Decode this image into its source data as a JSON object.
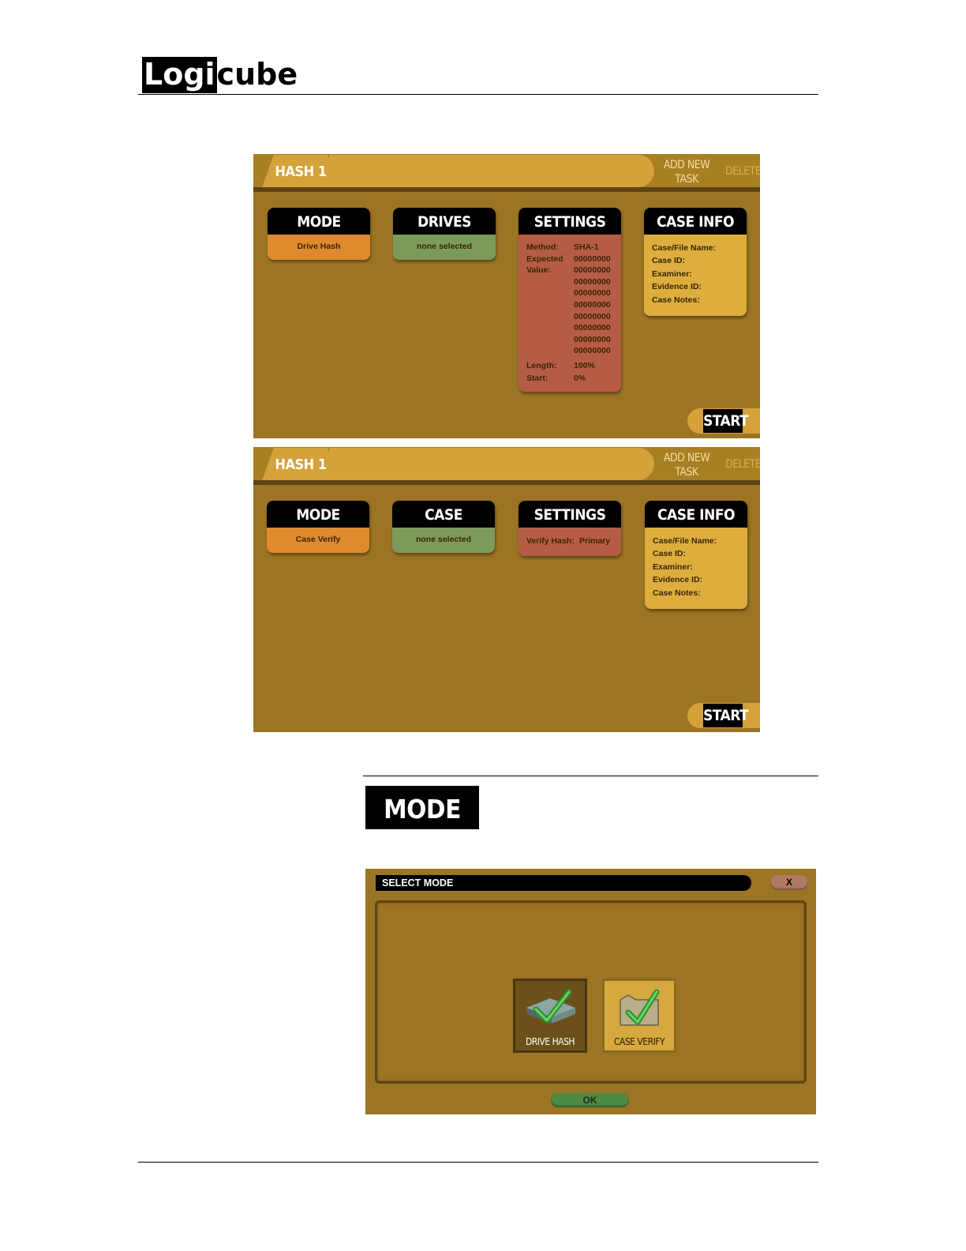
{
  "header": {
    "logo_box": "Logi",
    "logo_rest": "cube"
  },
  "screen1": {
    "tab": "HASH 1",
    "add_task": [
      "ADD NEW",
      "TASK"
    ],
    "delete": "DELETE",
    "mode": {
      "title": "MODE",
      "value": "Drive Hash"
    },
    "drives": {
      "title": "DRIVES",
      "value": "none selected"
    },
    "settings": {
      "title": "SETTINGS",
      "method_label": "Method:",
      "method_value": "SHA-1",
      "expected_label": "Expected",
      "value_label": "Value:",
      "hash_lines": [
        "00000000",
        "00000000",
        "00000000",
        "00000000",
        "00000000",
        "00000000",
        "00000000",
        "00000000",
        "00000000"
      ],
      "length_label": "Length:",
      "length_value": "100%",
      "start_label": "Start:",
      "start_value": "0%"
    },
    "case_info": {
      "title": "CASE INFO",
      "fields": [
        "Case/File Name:",
        "Case ID:",
        "Examiner:",
        "Evidence ID:",
        "Case Notes:"
      ]
    },
    "start": "START"
  },
  "screen2": {
    "tab": "HASH 1",
    "add_task": [
      "ADD NEW",
      "TASK"
    ],
    "delete": "DELETE",
    "mode": {
      "title": "MODE",
      "value": "Case Verify"
    },
    "case": {
      "title": "CASE",
      "value": "none selected"
    },
    "settings": {
      "title": "SETTINGS",
      "verify_label": "Verify Hash:",
      "verify_value": "Primary"
    },
    "case_info": {
      "title": "CASE INFO",
      "fields": [
        "Case/File Name:",
        "Case ID:",
        "Examiner:",
        "Evidence ID:",
        "Case Notes:"
      ]
    },
    "start": "START"
  },
  "mode_heading": "MODE",
  "dialog": {
    "title": "SELECT MODE",
    "close": "X",
    "options": [
      {
        "label": "DRIVE HASH",
        "selected": true
      },
      {
        "label": "CASE VERIFY",
        "selected": false
      }
    ],
    "ok": "OK"
  },
  "colors": {
    "background": "#9b7424",
    "gold": "#ddae3d",
    "orange": "#df8a2e",
    "green": "#7d9a5d",
    "red": "#b65c46"
  }
}
